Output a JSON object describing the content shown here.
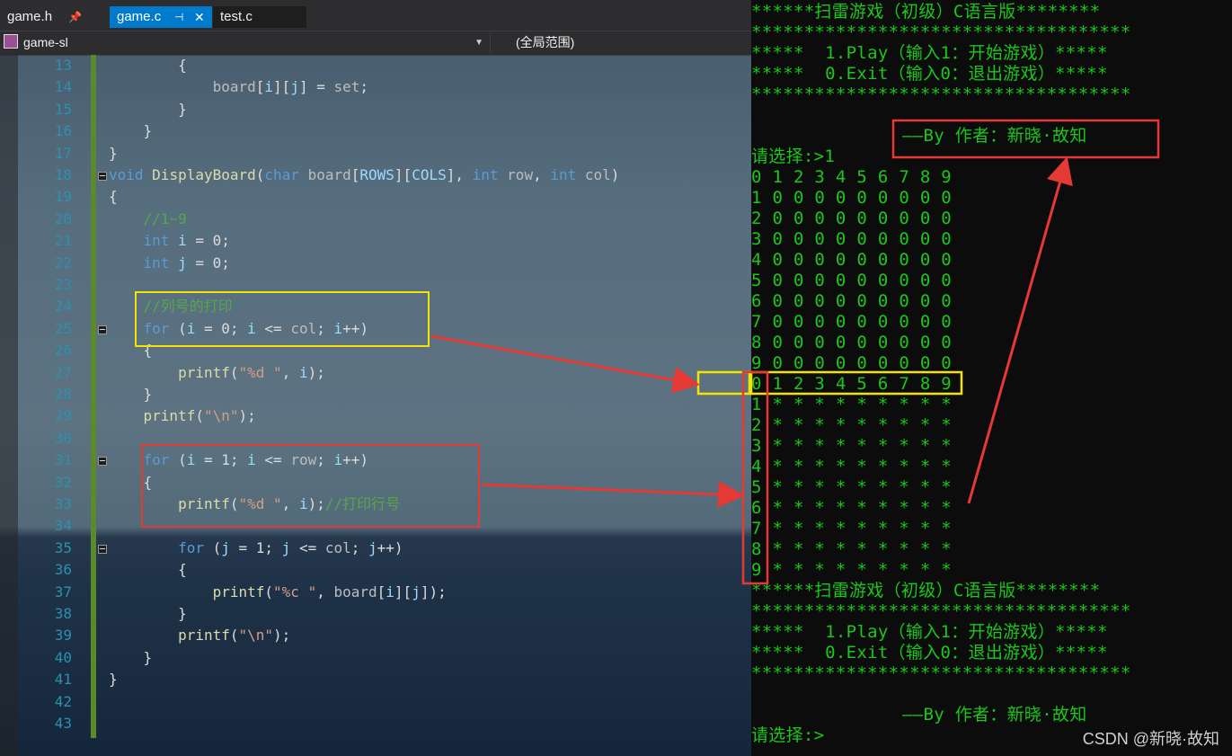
{
  "editor": {
    "tabs": [
      {
        "label": "game.h",
        "pin": "⊕"
      },
      {
        "label": "game.c",
        "pin": "⊣",
        "close": "✕"
      },
      {
        "label": "test.c"
      }
    ],
    "nav": {
      "project": "game-sl",
      "scope": "(全局范围)"
    },
    "lines": [
      {
        "n": "13",
        "code": "        {"
      },
      {
        "n": "14",
        "code": "            board[i][j] = set;"
      },
      {
        "n": "15",
        "code": "        }"
      },
      {
        "n": "16",
        "code": "    }"
      },
      {
        "n": "17",
        "code": "}"
      },
      {
        "n": "18",
        "code": "void DisplayBoard(char board[ROWS][COLS], int row, int col)"
      },
      {
        "n": "19",
        "code": "{"
      },
      {
        "n": "20",
        "code": "    //1~9"
      },
      {
        "n": "21",
        "code": "    int i = 0;"
      },
      {
        "n": "22",
        "code": "    int j = 0;"
      },
      {
        "n": "23",
        "code": ""
      },
      {
        "n": "24",
        "code": "    //列号的打印"
      },
      {
        "n": "25",
        "code": "    for (i = 0; i <= col; i++)"
      },
      {
        "n": "26",
        "code": "    {"
      },
      {
        "n": "27",
        "code": "        printf(\"%d \", i);"
      },
      {
        "n": "28",
        "code": "    }"
      },
      {
        "n": "29",
        "code": "    printf(\"\\n\");"
      },
      {
        "n": "30",
        "code": ""
      },
      {
        "n": "31",
        "code": "    for (i = 1; i <= row; i++)"
      },
      {
        "n": "32",
        "code": "    {"
      },
      {
        "n": "33",
        "code": "        printf(\"%d \", i);//打印行号"
      },
      {
        "n": "34",
        "code": ""
      },
      {
        "n": "35",
        "code": "        for (j = 1; j <= col; j++)"
      },
      {
        "n": "36",
        "code": "        {"
      },
      {
        "n": "37",
        "code": "            printf(\"%c \", board[i][j]);"
      },
      {
        "n": "38",
        "code": "        }"
      },
      {
        "n": "39",
        "code": "        printf(\"\\n\");"
      },
      {
        "n": "40",
        "code": "    }"
      },
      {
        "n": "41",
        "code": "}"
      },
      {
        "n": "42",
        "code": ""
      },
      {
        "n": "43",
        "code": ""
      }
    ]
  },
  "console": {
    "menu_top": [
      "******扫雷游戏（初级）C语言版********",
      "************************************",
      "*****  1.Play（输入1：开始游戏）*****",
      "*****  0.Exit（输入0：退出游戏）*****",
      "************************************"
    ],
    "author": "——By 作者：新晓·故知",
    "prompt1": "请选择:>1",
    "board1_rows": [
      "0 1 2 3 4 5 6 7 8 9",
      "1 0 0 0 0 0 0 0 0 0",
      "2 0 0 0 0 0 0 0 0 0",
      "3 0 0 0 0 0 0 0 0 0",
      "4 0 0 0 0 0 0 0 0 0",
      "5 0 0 0 0 0 0 0 0 0",
      "6 0 0 0 0 0 0 0 0 0",
      "7 0 0 0 0 0 0 0 0 0",
      "8 0 0 0 0 0 0 0 0 0",
      "9 0 0 0 0 0 0 0 0 0"
    ],
    "board2_rows": [
      "0 1 2 3 4 5 6 7 8 9",
      "1 * * * * * * * * *",
      "2 * * * * * * * * *",
      "3 * * * * * * * * *",
      "4 * * * * * * * * *",
      "5 * * * * * * * * *",
      "6 * * * * * * * * *",
      "7 * * * * * * * * *",
      "8 * * * * * * * * *",
      "9 * * * * * * * * *"
    ],
    "menu_bottom": [
      "******扫雷游戏（初级）C语言版********",
      "************************************",
      "*****  1.Play（输入1：开始游戏）*****",
      "*****  0.Exit（输入0：退出游戏）*****",
      "************************************"
    ],
    "author2": "——By 作者：新晓·故知",
    "prompt2": "请选择:>"
  },
  "watermark": "CSDN @新晓·故知",
  "colors": {
    "console_text": "#19c819",
    "annotation_red": "#e53935",
    "annotation_yellow": "#f5e400",
    "tab_active": "#007acc"
  }
}
